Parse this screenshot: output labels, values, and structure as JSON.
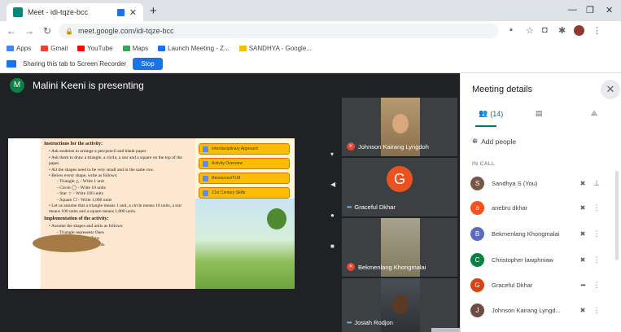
{
  "browser": {
    "tab_title": "Meet - idi-tqze-bcc",
    "new_tab": "+",
    "url": "meet.google.com/idi-tqze-bcc",
    "bookmarks": [
      "Apps",
      "Gmail",
      "YouTube",
      "Maps",
      "Launch Meeting - Z...",
      "SANDHYA - Google..."
    ],
    "bookmark_colors": [
      "#4285f4",
      "#ea4335",
      "#ff0000",
      "#34a853",
      "#1a73e8",
      "#fbbc04"
    ]
  },
  "share_notice": {
    "text": "Sharing this tab to Screen Recorder",
    "stop_label": "Stop"
  },
  "meet": {
    "presenter_initial": "M",
    "presenter_text": "Malini Keeni is presenting",
    "slide": {
      "heading1": "Instructions for the activity:",
      "bullets": [
        "• Ask students to arrange a pen/pencil and blank paper.",
        "• Ask them to draw a triangle, a circle, a star and a square on the top of the paper.",
        "• All the shapes need to be very small and in the same row.",
        "• Below every shape, write as follows:"
      ],
      "shape_lines": [
        "- Triangle △ - Write 1 unit",
        "- Circle ◯ - Write 10 units",
        "- Star ☆ - Write 100 units",
        "- Square ☐ - Write 1,000 units"
      ],
      "bullet_final": "• Let us assume that a triangle means 1 unit, a circle means 10 units, a star means 100 units and a square means 1,000 units.",
      "heading2": "Implementation of the activity:",
      "impl_lines": [
        "• Assume the shapes and units as follows:",
        "- Triangle represents Ones",
        "- Circle represents Tens",
        "- Star represents Hundreds"
      ],
      "buttons": [
        "Interdisciplinary Approach",
        "Activity Overview",
        "Resources/TLM",
        "21st Century Skills"
      ]
    },
    "tiles": [
      {
        "name": "Johnson Kairang Lyngdoh",
        "muted": true
      },
      {
        "name": "Graceful Dkhar",
        "initial": "G",
        "muted": false
      },
      {
        "name": "Bekmenlang Khongmalai",
        "muted": true
      },
      {
        "name": "Josiah Rodjon",
        "muted": false
      }
    ]
  },
  "panel": {
    "title": "Meeting details",
    "people_count": "(14)",
    "add_people": "Add people",
    "in_call": "IN CALL",
    "participants": [
      {
        "name": "Sandhya S (You)",
        "initial": "S",
        "color": "#795548"
      },
      {
        "name": "anebru dkhar",
        "initial": "a",
        "color": "#f4511e"
      },
      {
        "name": "Bekmenlang Khongmalai",
        "initial": "B",
        "color": "#5c6bc0"
      },
      {
        "name": "Christopher lawphniaw",
        "initial": "C",
        "color": "#0b8043"
      },
      {
        "name": "Graceful Dkhar",
        "initial": "G",
        "color": "#d84315"
      },
      {
        "name": "Johnson Kairang Lyngd...",
        "initial": "J",
        "color": "#6d4c41"
      }
    ]
  }
}
